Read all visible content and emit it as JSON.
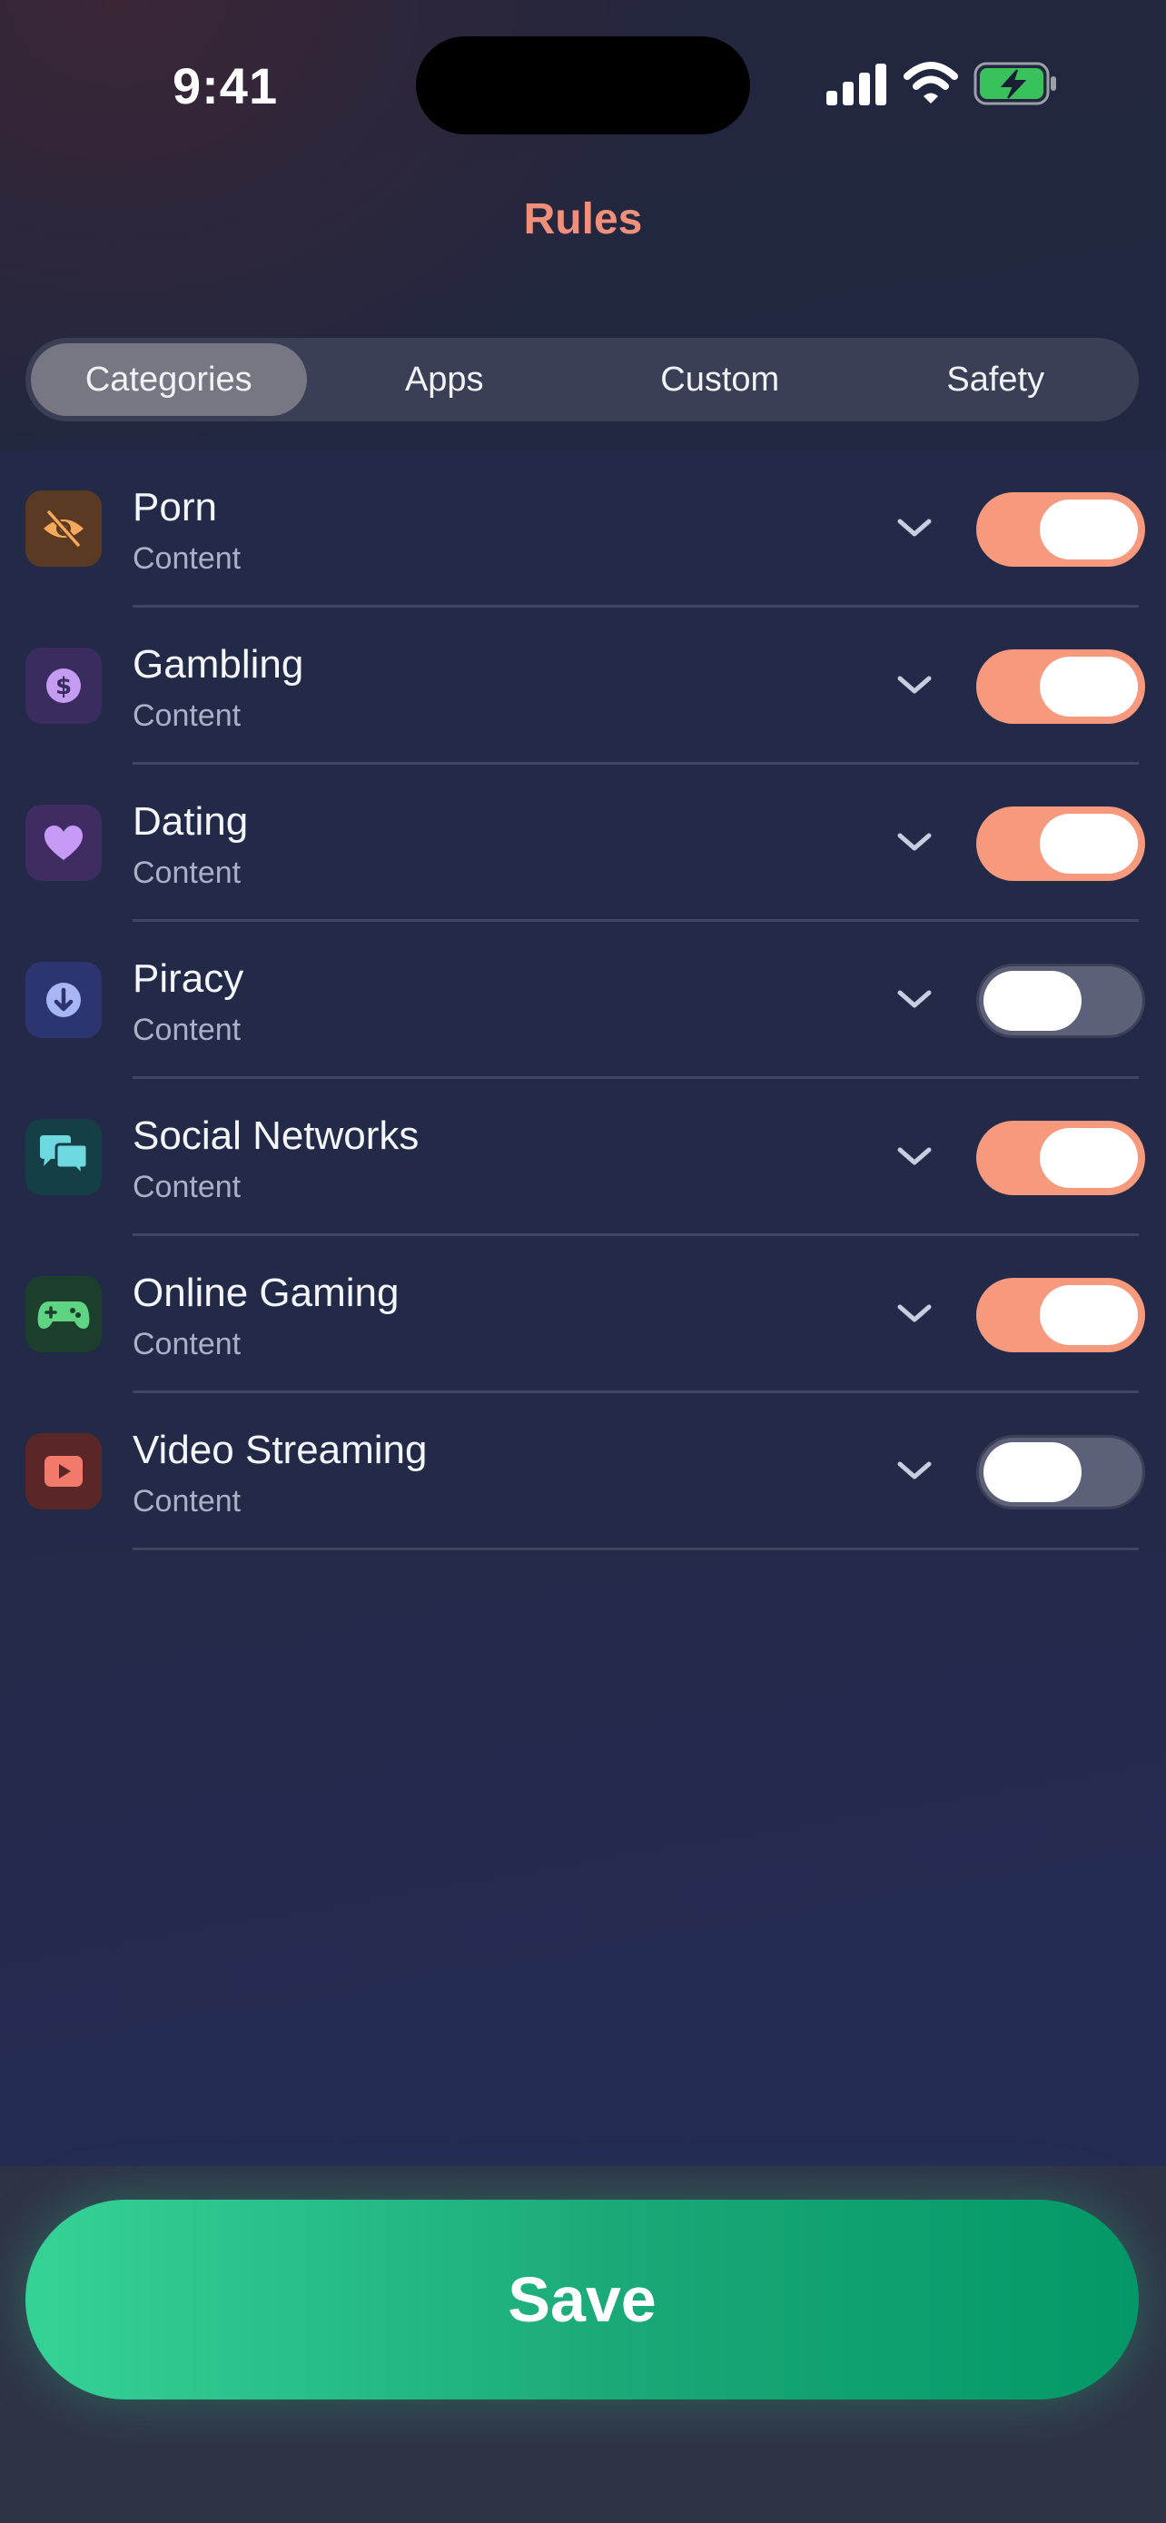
{
  "status": {
    "time": "9:41"
  },
  "header": {
    "title": "Rules"
  },
  "tabs": [
    {
      "label": "Categories",
      "active": true
    },
    {
      "label": "Apps",
      "active": false
    },
    {
      "label": "Custom",
      "active": false
    },
    {
      "label": "Safety",
      "active": false
    }
  ],
  "rules": [
    {
      "name": "Porn",
      "subtitle": "Content",
      "enabled": true,
      "icon": "eye-off-icon",
      "icon_bg": "#5a3a22",
      "icon_color": "#f7a95b"
    },
    {
      "name": "Gambling",
      "subtitle": "Content",
      "enabled": true,
      "icon": "dollar-coin-icon",
      "icon_bg": "#3b2c5f",
      "icon_color": "#c49cf2"
    },
    {
      "name": "Dating",
      "subtitle": "Content",
      "enabled": true,
      "icon": "heart-icon",
      "icon_bg": "#3e2c62",
      "icon_color": "#c79af5"
    },
    {
      "name": "Piracy",
      "subtitle": "Content",
      "enabled": false,
      "icon": "download-circle-icon",
      "icon_bg": "#2d3570",
      "icon_color": "#a9b6f5"
    },
    {
      "name": "Social Networks",
      "subtitle": "Content",
      "enabled": true,
      "icon": "chat-bubbles-icon",
      "icon_bg": "#153f47",
      "icon_color": "#6ed8e0"
    },
    {
      "name": "Online Gaming",
      "subtitle": "Content",
      "enabled": true,
      "icon": "gamepad-icon",
      "icon_bg": "#1c3f2d",
      "icon_color": "#5fd482"
    },
    {
      "name": "Video Streaming",
      "subtitle": "Content",
      "enabled": false,
      "icon": "play-video-icon",
      "icon_bg": "#5a2628",
      "icon_color": "#f27a6a"
    }
  ],
  "footer": {
    "save_label": "Save"
  },
  "colors": {
    "accent": "#f7997c",
    "save_green": "#19a877",
    "title": "#f0907a"
  }
}
